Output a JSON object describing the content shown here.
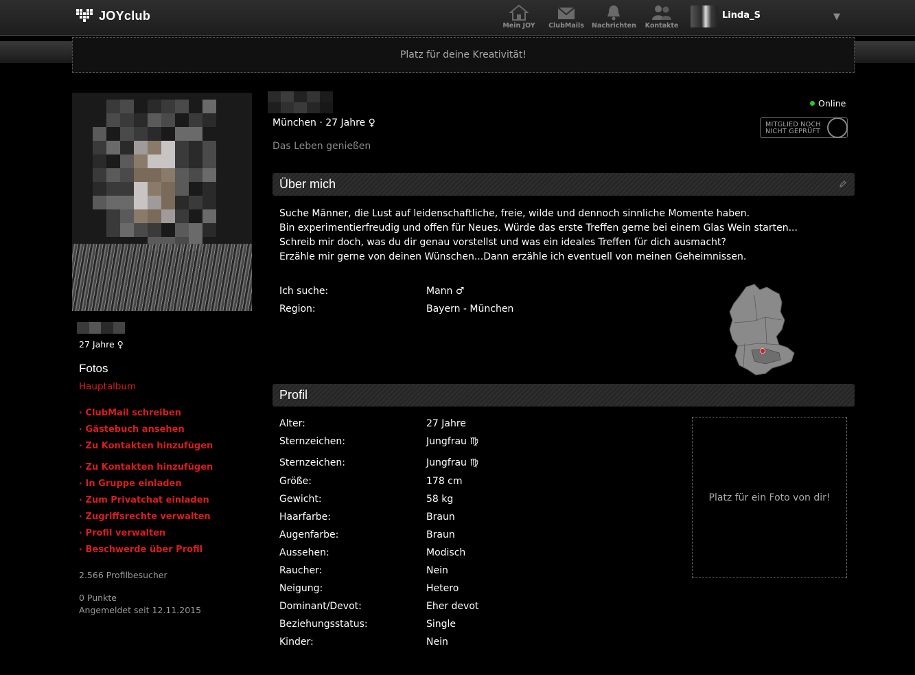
{
  "app": {
    "logo_text": "JOYclub"
  },
  "nav": [
    {
      "label": "Mein JOY",
      "icon": "home-icon"
    },
    {
      "label": "ClubMails",
      "icon": "mail-icon"
    },
    {
      "label": "Nachrichten",
      "icon": "bell-icon"
    },
    {
      "label": "Kontakte",
      "icon": "contacts-icon"
    }
  ],
  "user": {
    "name": "Linda_S"
  },
  "banner": {
    "text": "Platz für deine Kreativität!"
  },
  "profile": {
    "left_age": "27 Jahre ♀",
    "head_info": "München · 27 Jahre ♀",
    "motto": "Das Leben genießen",
    "online": "Online",
    "badge_line1": "MITGLIED NOCH",
    "badge_line2": "NICHT GEPRÜFT"
  },
  "sidebar": {
    "fotos_title": "Fotos",
    "album_link": "Hauptalbum",
    "actions": [
      "ClubMail schreiben",
      "Gästebuch ansehen",
      "Zu Kontakten hinzufügen",
      "Zu Kontakten hinzufügen",
      "In Gruppe einladen",
      "Zum Privatchat einladen",
      "Zugriffsrechte verwalten",
      "Profil verwalten",
      "Beschwerde über Profil"
    ],
    "visitors": "2.566 Profilbesucher",
    "points": "0 Punkte",
    "registered": "Angemeldet seit 12.11.2015"
  },
  "about": {
    "title": "Über mich",
    "lines": [
      "Suche Männer, die Lust auf leidenschaftliche, freie, wilde und dennoch sinnliche Momente haben.",
      "Bin experimentierfreudig und offen für Neues. Würde das erste Treffen gerne bei einem Glas Wein starten...",
      "Schreib mir doch, was du dir genau vorstellst und was ein ideales Treffen für dich ausmacht?",
      "Erzähle mir gerne von deinen Wünschen...Dann erzähle ich eventuell von meinen Geheimnissen."
    ],
    "search_label": "Ich suche:",
    "search_value": "Mann ♂",
    "region_label": "Region:",
    "region_value": "Bayern - München"
  },
  "profil": {
    "title": "Profil",
    "rows": [
      {
        "label": "Alter:",
        "value": "27 Jahre"
      },
      {
        "label": "Sternzeichen:",
        "value": "Jungfrau ♍"
      },
      {
        "label": "Sternzeichen:",
        "value": "Jungfrau ♍"
      },
      {
        "label": "Größe:",
        "value": "178 cm"
      },
      {
        "label": "Gewicht:",
        "value": "58 kg"
      },
      {
        "label": "Haarfarbe:",
        "value": "Braun"
      },
      {
        "label": "Augenfarbe:",
        "value": "Braun"
      },
      {
        "label": "Aussehen:",
        "value": "Modisch"
      },
      {
        "label": "Raucher:",
        "value": "Nein"
      },
      {
        "label": "Neigung:",
        "value": "Hetero"
      },
      {
        "label": "Dominant/Devot:",
        "value": "Eher devot"
      },
      {
        "label": "Beziehungsstatus:",
        "value": "Single"
      },
      {
        "label": "Kinder:",
        "value": "Nein"
      }
    ],
    "photo_slot": "Platz für ein Foto von dir!"
  },
  "colors": {
    "accent_red": "#d61e1e",
    "online_green": "#2ec42e"
  }
}
